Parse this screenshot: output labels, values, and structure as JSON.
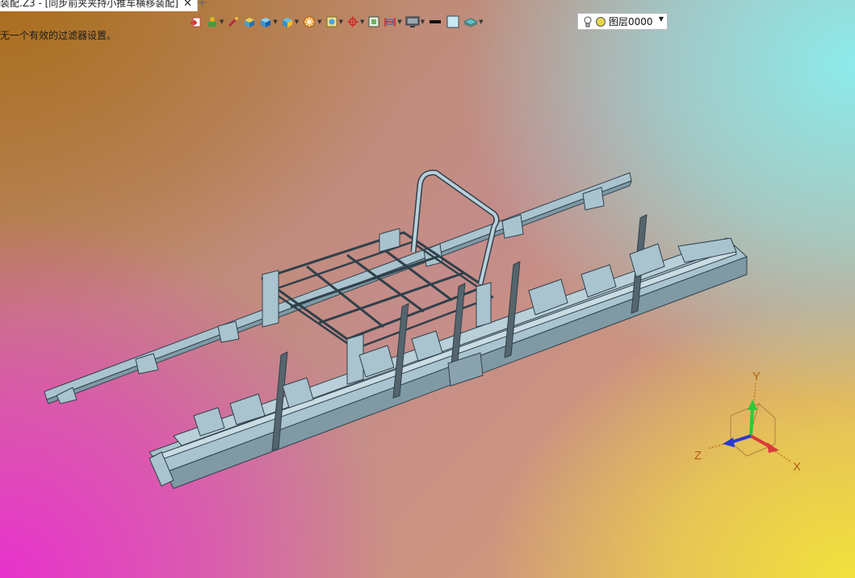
{
  "document_tab": {
    "title": "装配.Z3 - [同步前夹夹持小推车横移装配]",
    "close": "✕",
    "add": "+"
  },
  "status_message": "无一个有效的过滤器设置。",
  "toolbar": {
    "icons": [
      "import-icon",
      "feature-icon",
      "brush-icon",
      "box-icon",
      "solid-view-icon",
      "render-icon",
      "section-icon",
      "frame-icon",
      "origin-icon",
      "snap-icon",
      "dimension-icon",
      "display-icon",
      "line-color-icon",
      "fill-color-icon",
      "layer-filter-icon"
    ]
  },
  "layer": {
    "name": "图层0000",
    "status_color": "#e6d84a"
  },
  "triad": {
    "x": "X",
    "y": "Y",
    "z": "Z",
    "x_color": "#d83a3a",
    "y_color": "#2ec83a",
    "z_color": "#2a3ad0"
  },
  "colors": {
    "model_fill": "#a9c4cf",
    "model_stroke": "#30404a"
  }
}
